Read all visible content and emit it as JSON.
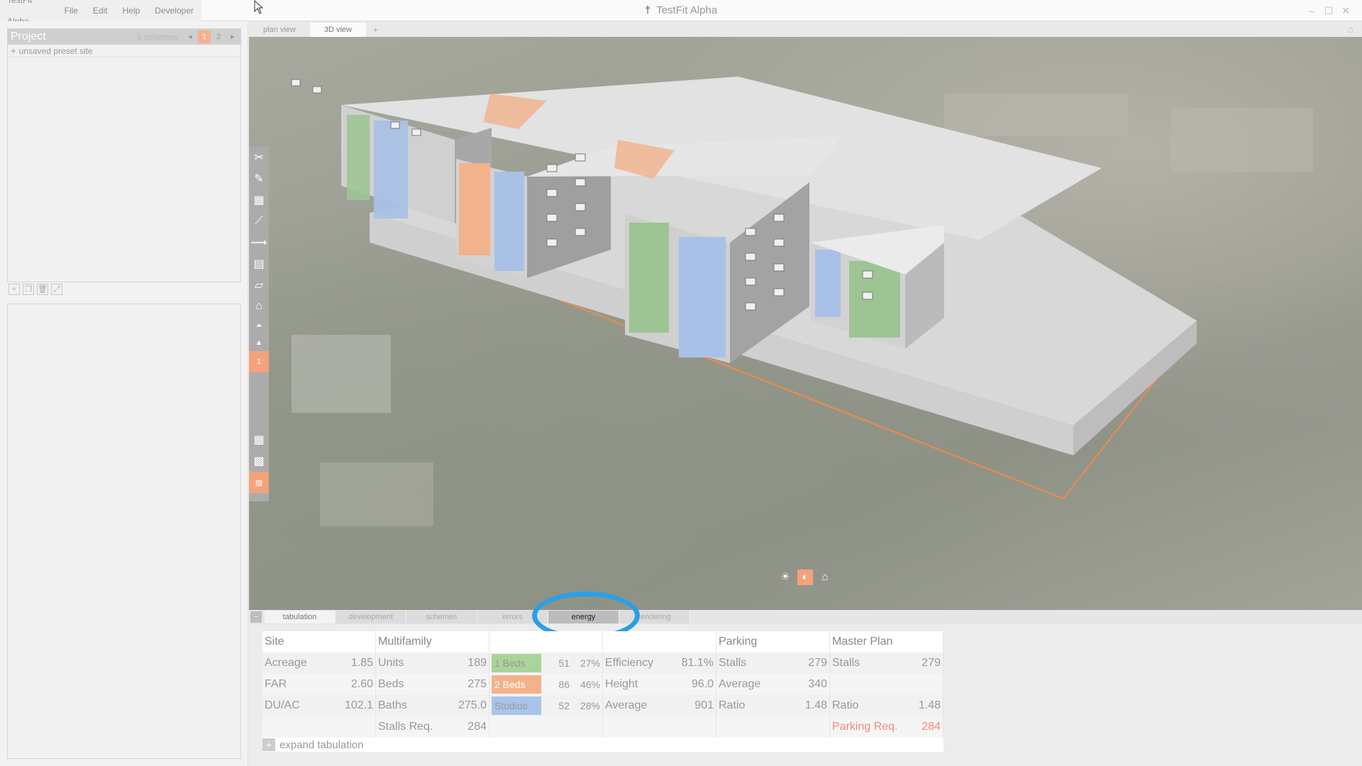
{
  "app": {
    "title": "TestFit Alpha",
    "menu": [
      "TestFit Alpha",
      "File",
      "Edit",
      "Help",
      "Developer"
    ]
  },
  "project": {
    "title": "Project",
    "schemes_label": "5 schemes",
    "pages": [
      "1",
      "2"
    ],
    "active_page": "1",
    "preset_label": "unsaved preset site"
  },
  "view_tabs": {
    "plan": "plan view",
    "three_d": "3D view",
    "add": "+"
  },
  "floor_indicator": "1",
  "bottom_tabs": [
    "tabulation",
    "development",
    "schemes",
    "errors",
    "energy",
    "rendering"
  ],
  "highlighted_tab": "energy",
  "tabulation": {
    "site": {
      "header": "Site",
      "rows": [
        {
          "label": "Acreage",
          "value": "1.85"
        },
        {
          "label": "FAR",
          "value": "2.60"
        },
        {
          "label": "DU/AC",
          "value": "102.1"
        }
      ]
    },
    "multifamily": {
      "header": "Multifamily",
      "rows": [
        {
          "label": "Units",
          "value": "189"
        },
        {
          "label": "Beds",
          "value": "275"
        },
        {
          "label": "Baths",
          "value": "275.0"
        },
        {
          "label": "Stalls Req.",
          "value": "284"
        }
      ]
    },
    "unit_mix": [
      {
        "label": "1 Beds",
        "count": "51",
        "pct": "27%",
        "color": "#a9d49a"
      },
      {
        "label": "2 Beds",
        "count": "86",
        "pct": "46%",
        "color": "#f4b28b"
      },
      {
        "label": "Studios",
        "count": "52",
        "pct": "28%",
        "color": "#a9c4ea"
      }
    ],
    "building": {
      "rows": [
        {
          "label": "Efficiency",
          "value": "81.1%"
        },
        {
          "label": "Height",
          "value": "96.0"
        },
        {
          "label": "Average",
          "value": "901"
        }
      ]
    },
    "parking": {
      "header": "Parking",
      "rows": [
        {
          "label": "Stalls",
          "value": "279"
        },
        {
          "label": "Average",
          "value": "340"
        },
        {
          "label": "Ratio",
          "value": "1.48"
        }
      ]
    },
    "master_plan": {
      "header": "Master Plan",
      "rows": [
        {
          "label": "Stalls",
          "value": "279"
        },
        {
          "label": "",
          "value": ""
        },
        {
          "label": "Ratio",
          "value": "1.48"
        },
        {
          "label": "Parking Req.",
          "value": "284"
        }
      ]
    },
    "expand_label": "expand tabulation"
  },
  "colors": {
    "accent_orange": "#f4a27b",
    "highlight_blue": "#2b9fe6",
    "site_outline": "#f08a4b"
  }
}
